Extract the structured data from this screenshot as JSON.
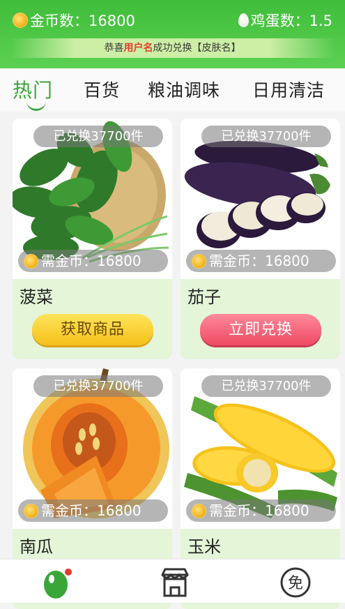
{
  "header": {
    "coin_label": "金币数：16800",
    "egg_label": "鸡蛋数：1.5",
    "notice_prefix": "恭喜",
    "notice_user": "用户名",
    "notice_suffix": "成功兑换【皮肤名】"
  },
  "tabs": [
    {
      "label": "热门",
      "active": true
    },
    {
      "label": "百货",
      "active": false
    },
    {
      "label": "粮油调味",
      "active": false
    },
    {
      "label": "日用清洁",
      "active": false
    }
  ],
  "products": [
    {
      "name": "菠菜",
      "redeemed": "已兑换37700件",
      "price": "需金币：16800",
      "button": "获取商品",
      "button_style": "yellow",
      "image": "spinach-image"
    },
    {
      "name": "茄子",
      "redeemed": "已兑换37700件",
      "price": "需金币：16800",
      "button": "立即兑换",
      "button_style": "pink",
      "image": "eggplant-image"
    },
    {
      "name": "南瓜",
      "redeemed": "已兑换37700件",
      "price": "需金币：16800",
      "image": "pumpkin-image"
    },
    {
      "name": "玉米",
      "redeemed": "已兑换37700件",
      "price": "需金币：16800",
      "image": "corn-image"
    }
  ],
  "bottom_nav": [
    {
      "icon": "egg-home-icon"
    },
    {
      "icon": "shop-icon"
    },
    {
      "icon": "free-icon",
      "label": "免"
    }
  ],
  "colors": {
    "header_green": "#4cc645",
    "accent_green": "#3aa63a",
    "highlight_red": "#e53a2c",
    "yellow_button": "#f4c21a",
    "pink_button": "#ef4a63"
  }
}
